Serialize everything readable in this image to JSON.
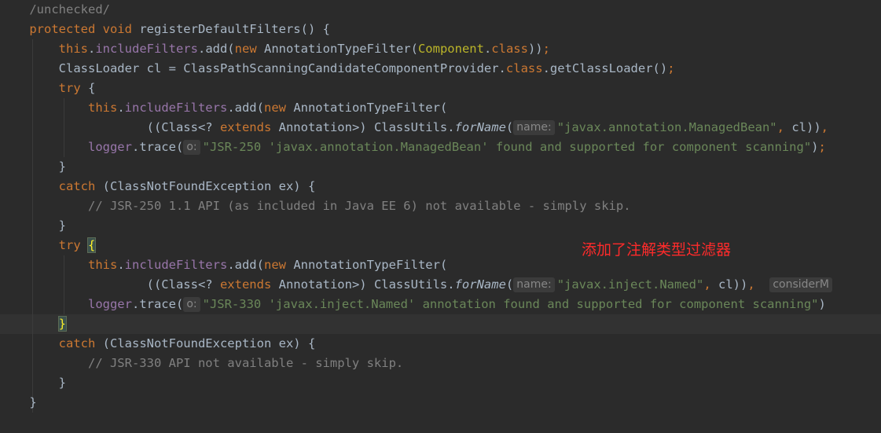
{
  "editor": {
    "lines": [
      {
        "id": "l0",
        "parts": [
          {
            "c": "plain",
            "t": "    "
          },
          {
            "c": "cmt",
            "t": "/unchecked/"
          }
        ]
      },
      {
        "id": "l1",
        "parts": [
          {
            "c": "plain",
            "t": "    "
          },
          {
            "c": "kw",
            "t": "protected void "
          },
          {
            "c": "plain",
            "t": "registerDefaultFilters() {"
          }
        ]
      },
      {
        "id": "l2",
        "parts": [
          {
            "c": "plain",
            "t": "        "
          },
          {
            "c": "kw",
            "t": "this"
          },
          {
            "c": "plain",
            "t": "."
          },
          {
            "c": "fld",
            "t": "includeFilters"
          },
          {
            "c": "plain",
            "t": ".add("
          },
          {
            "c": "kw",
            "t": "new "
          },
          {
            "c": "plain",
            "t": "AnnotationTypeFilter("
          },
          {
            "c": "ann",
            "t": "Component"
          },
          {
            "c": "plain",
            "t": "."
          },
          {
            "c": "kw",
            "t": "class"
          },
          {
            "c": "plain",
            "t": "))"
          },
          {
            "c": "kw",
            "t": ";"
          }
        ]
      },
      {
        "id": "l3",
        "parts": [
          {
            "c": "plain",
            "t": "        ClassLoader cl = ClassPathScanningCandidateComponentProvider."
          },
          {
            "c": "kw",
            "t": "class"
          },
          {
            "c": "plain",
            "t": ".getClassLoader()"
          },
          {
            "c": "kw",
            "t": ";"
          }
        ]
      },
      {
        "id": "l4",
        "parts": [
          {
            "c": "plain",
            "t": "        "
          },
          {
            "c": "kw",
            "t": "try "
          },
          {
            "c": "plain",
            "t": "{"
          }
        ]
      },
      {
        "id": "l5",
        "parts": [
          {
            "c": "plain",
            "t": "            "
          },
          {
            "c": "kw",
            "t": "this"
          },
          {
            "c": "plain",
            "t": "."
          },
          {
            "c": "fld",
            "t": "includeFilters"
          },
          {
            "c": "plain",
            "t": ".add("
          },
          {
            "c": "kw",
            "t": "new "
          },
          {
            "c": "plain",
            "t": "AnnotationTypeFilter("
          }
        ]
      },
      {
        "id": "l6",
        "parts": [
          {
            "c": "plain",
            "t": "                    ((Class<? "
          },
          {
            "c": "kw",
            "t": "extends "
          },
          {
            "c": "plain",
            "t": "Annotation>) ClassUtils."
          },
          {
            "c": "static",
            "t": "forName"
          },
          {
            "c": "plain",
            "t": "("
          },
          {
            "c": "hint",
            "t": "name:"
          },
          {
            "c": "str",
            "t": "\"javax.annotation.ManagedBean\""
          },
          {
            "c": "kw",
            "t": ", "
          },
          {
            "c": "plain",
            "t": "cl))"
          },
          {
            "c": "kw",
            "t": ","
          }
        ]
      },
      {
        "id": "l7",
        "parts": [
          {
            "c": "plain",
            "t": "            "
          },
          {
            "c": "fld",
            "t": "logger"
          },
          {
            "c": "plain",
            "t": ".trace("
          },
          {
            "c": "hint",
            "t": "o:"
          },
          {
            "c": "str",
            "t": "\"JSR-250 'javax.annotation.ManagedBean' found and supported for component scanning\""
          },
          {
            "c": "plain",
            "t": ")"
          },
          {
            "c": "kw",
            "t": ";"
          }
        ]
      },
      {
        "id": "l8",
        "parts": [
          {
            "c": "plain",
            "t": "        }"
          }
        ]
      },
      {
        "id": "l9",
        "parts": [
          {
            "c": "plain",
            "t": "        "
          },
          {
            "c": "kw",
            "t": "catch "
          },
          {
            "c": "plain",
            "t": "(ClassNotFoundException ex) {"
          }
        ]
      },
      {
        "id": "l10",
        "parts": [
          {
            "c": "plain",
            "t": "            "
          },
          {
            "c": "cmt",
            "t": "// JSR-250 1.1 API (as included in Java EE 6) not available - simply skip."
          }
        ]
      },
      {
        "id": "l11",
        "parts": [
          {
            "c": "plain",
            "t": "        }"
          }
        ]
      },
      {
        "id": "l12",
        "parts": [
          {
            "c": "plain",
            "t": "        "
          },
          {
            "c": "kw",
            "t": "try "
          },
          {
            "c": "brace-hl",
            "t": "{"
          }
        ]
      },
      {
        "id": "l13",
        "parts": [
          {
            "c": "plain",
            "t": "            "
          },
          {
            "c": "kw",
            "t": "this"
          },
          {
            "c": "plain",
            "t": "."
          },
          {
            "c": "fld",
            "t": "includeFilters"
          },
          {
            "c": "plain",
            "t": ".add("
          },
          {
            "c": "kw",
            "t": "new "
          },
          {
            "c": "plain",
            "t": "AnnotationTypeFilter("
          }
        ]
      },
      {
        "id": "l14",
        "parts": [
          {
            "c": "plain",
            "t": "                    ((Class<? "
          },
          {
            "c": "kw",
            "t": "extends "
          },
          {
            "c": "plain",
            "t": "Annotation>) ClassUtils."
          },
          {
            "c": "static",
            "t": "forName"
          },
          {
            "c": "plain",
            "t": "("
          },
          {
            "c": "hint",
            "t": "name:"
          },
          {
            "c": "str",
            "t": "\"javax.inject.Named\""
          },
          {
            "c": "kw",
            "t": ", "
          },
          {
            "c": "plain",
            "t": "cl))"
          },
          {
            "c": "kw",
            "t": ", "
          },
          {
            "c": "plain",
            "t": " "
          },
          {
            "c": "hint",
            "t": "considerM"
          }
        ]
      },
      {
        "id": "l15",
        "parts": [
          {
            "c": "plain",
            "t": "            "
          },
          {
            "c": "fld",
            "t": "logger"
          },
          {
            "c": "plain",
            "t": ".trace("
          },
          {
            "c": "hint",
            "t": "o:"
          },
          {
            "c": "str",
            "t": "\"JSR-330 'javax.inject.Named' annotation found and supported for component scanning\""
          },
          {
            "c": "plain",
            "t": ")"
          }
        ]
      },
      {
        "id": "l16",
        "parts": [
          {
            "c": "plain",
            "t": "        "
          },
          {
            "c": "brace-hl",
            "t": "}"
          }
        ]
      },
      {
        "id": "l17",
        "parts": [
          {
            "c": "plain",
            "t": "        "
          },
          {
            "c": "kw",
            "t": "catch "
          },
          {
            "c": "plain",
            "t": "(ClassNotFoundException ex) {"
          }
        ]
      },
      {
        "id": "l18",
        "parts": [
          {
            "c": "plain",
            "t": "            "
          },
          {
            "c": "cmt",
            "t": "// JSR-330 API not available - simply skip."
          }
        ]
      },
      {
        "id": "l19",
        "parts": [
          {
            "c": "plain",
            "t": "        }"
          }
        ]
      },
      {
        "id": "l20",
        "parts": [
          {
            "c": "plain",
            "t": "    }"
          }
        ]
      }
    ],
    "current_line_index": 16
  },
  "annotation_note": "添加了注解类型过滤器",
  "colors": {
    "background": "#2b2b2b",
    "keyword": "#cc7832",
    "field": "#9876aa",
    "string": "#6a8759",
    "comment": "#808080",
    "annotation": "#bbb529",
    "note": "#ff2b2b"
  }
}
